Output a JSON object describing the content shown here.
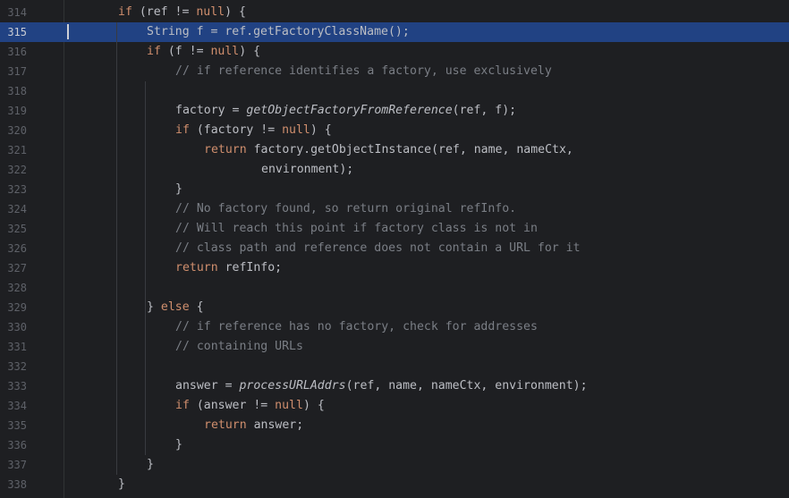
{
  "editor": {
    "theme_colors": {
      "background": "#1e1f22",
      "current_line": "#214283",
      "keyword": "#cf8e6d",
      "comment": "#7a7e85",
      "text": "#bcbec4",
      "line_number": "#5e6168"
    },
    "current_line_number": "315",
    "lines": [
      {
        "number": "314",
        "indent": 2,
        "tokens": [
          {
            "t": "kw",
            "v": "if"
          },
          {
            "t": "plain",
            "v": " (ref != "
          },
          {
            "t": "kw",
            "v": "null"
          },
          {
            "t": "plain",
            "v": ") {"
          }
        ]
      },
      {
        "number": "315",
        "indent": 3,
        "current": true,
        "tokens": [
          {
            "t": "plain",
            "v": "String f = ref.getFactoryClassName();"
          }
        ]
      },
      {
        "number": "316",
        "indent": 3,
        "tokens": [
          {
            "t": "kw",
            "v": "if"
          },
          {
            "t": "plain",
            "v": " (f != "
          },
          {
            "t": "kw",
            "v": "null"
          },
          {
            "t": "plain",
            "v": ") {"
          }
        ]
      },
      {
        "number": "317",
        "indent": 4,
        "tokens": [
          {
            "t": "cm",
            "v": "// if reference identifies a factory, use exclusively"
          }
        ]
      },
      {
        "number": "318",
        "indent": 0,
        "tokens": []
      },
      {
        "number": "319",
        "indent": 4,
        "tokens": [
          {
            "t": "plain",
            "v": "factory = "
          },
          {
            "t": "fn-italic",
            "v": "getObjectFactoryFromReference"
          },
          {
            "t": "plain",
            "v": "(ref, f);"
          }
        ]
      },
      {
        "number": "320",
        "indent": 4,
        "tokens": [
          {
            "t": "kw",
            "v": "if"
          },
          {
            "t": "plain",
            "v": " (factory != "
          },
          {
            "t": "kw",
            "v": "null"
          },
          {
            "t": "plain",
            "v": ") {"
          }
        ]
      },
      {
        "number": "321",
        "indent": 5,
        "tokens": [
          {
            "t": "kw",
            "v": "return"
          },
          {
            "t": "plain",
            "v": " factory.getObjectInstance(ref, name, nameCtx,"
          }
        ]
      },
      {
        "number": "322",
        "indent": 7,
        "tokens": [
          {
            "t": "plain",
            "v": "environment);"
          }
        ]
      },
      {
        "number": "323",
        "indent": 4,
        "tokens": [
          {
            "t": "plain",
            "v": "}"
          }
        ]
      },
      {
        "number": "324",
        "indent": 4,
        "tokens": [
          {
            "t": "cm",
            "v": "// No factory found, so return original refInfo."
          }
        ]
      },
      {
        "number": "325",
        "indent": 4,
        "tokens": [
          {
            "t": "cm",
            "v": "// Will reach this point if factory class is not in"
          }
        ]
      },
      {
        "number": "326",
        "indent": 4,
        "tokens": [
          {
            "t": "cm",
            "v": "// class path and reference does not contain a URL for it"
          }
        ]
      },
      {
        "number": "327",
        "indent": 4,
        "tokens": [
          {
            "t": "kw",
            "v": "return"
          },
          {
            "t": "plain",
            "v": " refInfo;"
          }
        ]
      },
      {
        "number": "328",
        "indent": 0,
        "tokens": []
      },
      {
        "number": "329",
        "indent": 3,
        "tokens": [
          {
            "t": "plain",
            "v": "} "
          },
          {
            "t": "kw",
            "v": "else"
          },
          {
            "t": "plain",
            "v": " {"
          }
        ]
      },
      {
        "number": "330",
        "indent": 4,
        "tokens": [
          {
            "t": "cm",
            "v": "// if reference has no factory, check for addresses"
          }
        ]
      },
      {
        "number": "331",
        "indent": 4,
        "tokens": [
          {
            "t": "cm",
            "v": "// containing URLs"
          }
        ]
      },
      {
        "number": "332",
        "indent": 0,
        "tokens": []
      },
      {
        "number": "333",
        "indent": 4,
        "tokens": [
          {
            "t": "plain",
            "v": "answer = "
          },
          {
            "t": "fn-italic",
            "v": "processURLAddrs"
          },
          {
            "t": "plain",
            "v": "(ref, name, nameCtx, environment);"
          }
        ]
      },
      {
        "number": "334",
        "indent": 4,
        "tokens": [
          {
            "t": "kw",
            "v": "if"
          },
          {
            "t": "plain",
            "v": " (answer != "
          },
          {
            "t": "kw",
            "v": "null"
          },
          {
            "t": "plain",
            "v": ") {"
          }
        ]
      },
      {
        "number": "335",
        "indent": 5,
        "tokens": [
          {
            "t": "kw",
            "v": "return"
          },
          {
            "t": "plain",
            "v": " answer;"
          }
        ]
      },
      {
        "number": "336",
        "indent": 4,
        "tokens": [
          {
            "t": "plain",
            "v": "}"
          }
        ]
      },
      {
        "number": "337",
        "indent": 3,
        "tokens": [
          {
            "t": "plain",
            "v": "}"
          }
        ]
      },
      {
        "number": "338",
        "indent": 2,
        "tokens": [
          {
            "t": "plain",
            "v": "}"
          }
        ]
      }
    ]
  }
}
